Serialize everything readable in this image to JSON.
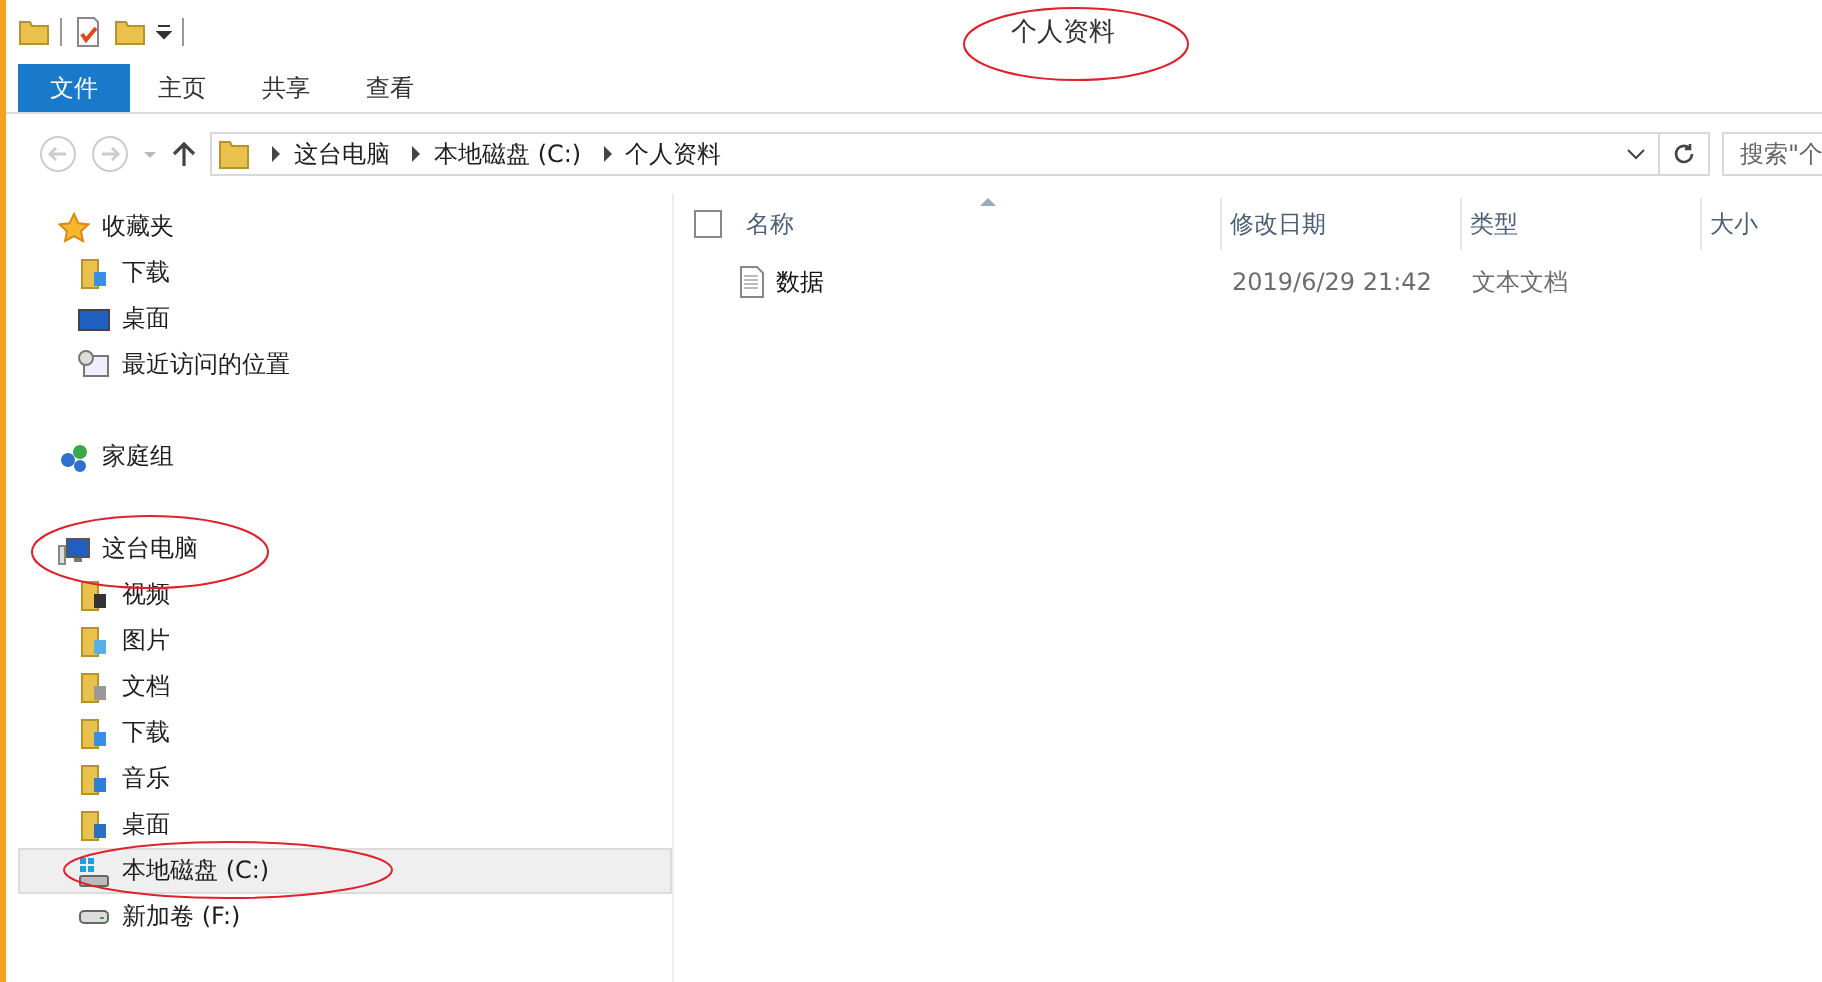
{
  "window": {
    "title": "个人资料"
  },
  "ribbon_tabs": [
    {
      "label": "文件",
      "kind": "filemenu",
      "selected": false
    },
    {
      "label": "主页",
      "kind": "tab",
      "selected": false
    },
    {
      "label": "共享",
      "kind": "tab",
      "selected": false
    },
    {
      "label": "查看",
      "kind": "tab",
      "selected": false
    }
  ],
  "address_bar": {
    "path": [
      "这台电脑",
      "本地磁盘 (C:)",
      "个人资料"
    ]
  },
  "search": {
    "placeholder": "搜索\"个"
  },
  "navigation_pane": [
    {
      "label": "收藏夹",
      "kind": "favorites",
      "selected": false,
      "children": [
        {
          "label": "下载",
          "kind": "download",
          "selected": false
        },
        {
          "label": "桌面",
          "kind": "desktop",
          "selected": false
        },
        {
          "label": "最近访问的位置",
          "kind": "recent",
          "selected": false
        }
      ]
    },
    {
      "label": "家庭组",
      "kind": "homegroup",
      "selected": false
    },
    {
      "label": "这台电脑",
      "kind": "computer",
      "selected": false,
      "children": [
        {
          "label": "视频",
          "kind": "video",
          "selected": false
        },
        {
          "label": "图片",
          "kind": "pictures",
          "selected": false
        },
        {
          "label": "文档",
          "kind": "documents",
          "selected": false
        },
        {
          "label": "下载",
          "kind": "download",
          "selected": false
        },
        {
          "label": "音乐",
          "kind": "music",
          "selected": false
        },
        {
          "label": "桌面",
          "kind": "desktopfolder",
          "selected": false
        },
        {
          "label": "本地磁盘 (C:)",
          "kind": "systemdrive",
          "selected": true
        },
        {
          "label": "新加卷 (F:)",
          "kind": "drive",
          "selected": false
        }
      ]
    }
  ],
  "file_list": {
    "select_all": {
      "checked": false
    },
    "columns": [
      {
        "label": "名称",
        "sorted": true
      },
      {
        "label": "修改日期",
        "sorted": false
      },
      {
        "label": "类型",
        "sorted": false
      },
      {
        "label": "大小",
        "sorted": false
      }
    ],
    "rows": [
      {
        "name": "数据",
        "modified": "2019/6/29 21:42",
        "type": "文本文档",
        "selected": false
      }
    ]
  }
}
